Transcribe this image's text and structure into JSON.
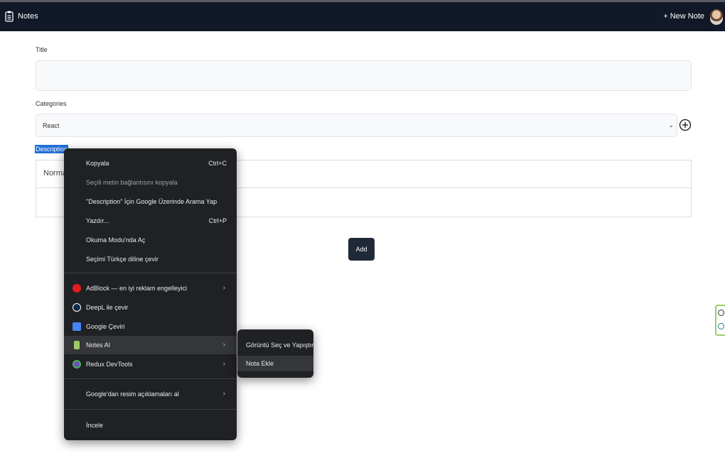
{
  "header": {
    "app_title": "Notes",
    "new_note_label": "+ New Note"
  },
  "form": {
    "title_label": "Title",
    "categories_label": "Categories",
    "category_value": "React",
    "description_label": "Description",
    "editor_format": "Normal",
    "add_label": "Add"
  },
  "context_menu": {
    "items": [
      {
        "label": "Kopyala",
        "shortcut": "Ctrl+C"
      },
      {
        "label": "Seçili metin bağlantısını kopyala"
      },
      {
        "label": "\"Description\" İçin Google Üzerinde Arama Yap"
      },
      {
        "label": "Yazdır...",
        "shortcut": "Ctrl+P"
      },
      {
        "label": "Okuma Modu'nda Aç"
      },
      {
        "label": "Seçimi Türkçe diline çevir"
      },
      {
        "label": "AdBlock — en iyi reklam engelleyici",
        "arrow": "›"
      },
      {
        "label": "DeepL ile çevir"
      },
      {
        "label": "Google Çeviri"
      },
      {
        "label": "Notes AI",
        "arrow": "›"
      },
      {
        "label": "Redux DevTools",
        "arrow": "›"
      },
      {
        "label": "Google'dan resim açıklamaları al",
        "arrow": "›"
      },
      {
        "label": "İncele"
      }
    ]
  },
  "submenu": {
    "items": [
      {
        "label": "Görüntü Seç ve Yapıştır"
      },
      {
        "label": "Nota Ekle"
      }
    ]
  },
  "colors": {
    "navbar": "#111827",
    "menu_bg": "#202124",
    "menu_highlight": "#35363a",
    "selection": "#1f6fd6"
  }
}
